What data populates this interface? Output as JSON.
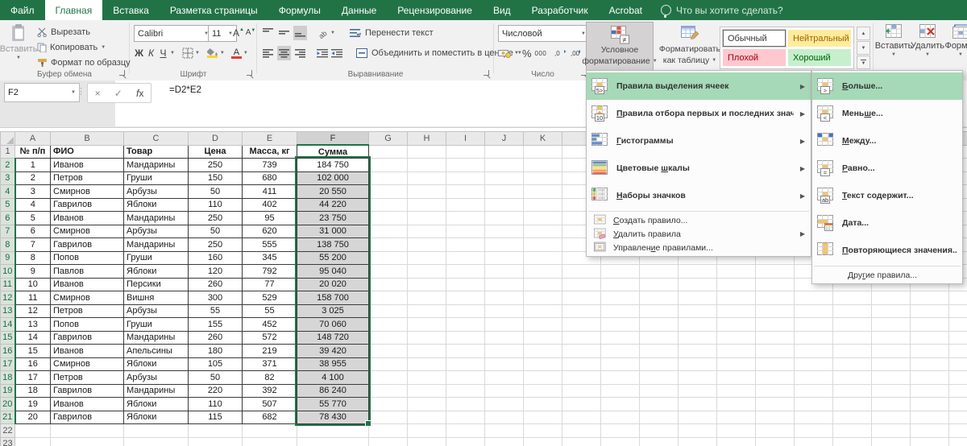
{
  "colors": {
    "excel_green": "#217346",
    "menu_highlight": "#A6D9B7",
    "selection_fill": "#D6D6D6",
    "selection_border": "#1F7245",
    "style_neutral_bg": "#FFEB9C",
    "style_neutral_fg": "#9C6500",
    "style_bad_bg": "#FFC7CE",
    "style_bad_fg": "#9C0006",
    "style_good_bg": "#C6EFCE",
    "style_good_fg": "#006100"
  },
  "tabs": {
    "items": [
      {
        "label": "Файл",
        "active": false
      },
      {
        "label": "Главная",
        "active": true
      },
      {
        "label": "Вставка",
        "active": false
      },
      {
        "label": "Разметка страницы",
        "active": false
      },
      {
        "label": "Формулы",
        "active": false
      },
      {
        "label": "Данные",
        "active": false
      },
      {
        "label": "Рецензирование",
        "active": false
      },
      {
        "label": "Вид",
        "active": false
      },
      {
        "label": "Разработчик",
        "active": false
      },
      {
        "label": "Acrobat",
        "active": false
      }
    ],
    "tell_me": "Что вы хотите сделать?"
  },
  "ribbon": {
    "clipboard": {
      "paste": "Вставить",
      "cut": "Вырезать",
      "copy": "Копировать",
      "format_painter": "Формат по образцу",
      "group": "Буфер обмена"
    },
    "font": {
      "name": "Calibri",
      "size": "11",
      "grow": "А",
      "shrink": "А",
      "bold": "Ж",
      "italic": "К",
      "underline": "Ч",
      "group": "Шрифт"
    },
    "alignment": {
      "wrap": "Перенести текст",
      "merge": "Объединить и поместить в центре",
      "group": "Выравнивание"
    },
    "number": {
      "format": "Числовой",
      "percent": "%",
      "zeros": "000",
      "group": "Число"
    },
    "styles": {
      "cond_line1": "Условное",
      "cond_line2": "форматирование",
      "table_line1": "Форматировать",
      "table_line2": "как таблицу",
      "chips": [
        {
          "label": "Обычный",
          "bg": "#FFFFFF",
          "fg": "#333333",
          "selected": true
        },
        {
          "label": "Нейтральный",
          "bg": "#FFEB9C",
          "fg": "#9C6500",
          "selected": false
        },
        {
          "label": "Плохой",
          "bg": "#FFC7CE",
          "fg": "#9C0006",
          "selected": false
        },
        {
          "label": "Хороший",
          "bg": "#C6EFCE",
          "fg": "#006100",
          "selected": false
        }
      ]
    },
    "cells": {
      "insert": "Вставить",
      "delete": "Удалить",
      "format": "Формат"
    }
  },
  "formula_bar": {
    "name_box": "F2",
    "formula": "=D2*E2"
  },
  "cf_menu": {
    "items": [
      {
        "label": "Правила выделения ячеек",
        "accel": -1,
        "icon": "highlight-cells-rules-icon",
        "sub": true,
        "hl": true
      },
      {
        "label": "Правила отбора первых и последних значений",
        "accel": 0,
        "icon": "top-bottom-rules-icon",
        "sub": true
      },
      {
        "label": "Гистограммы",
        "accel": 0,
        "icon": "data-bars-icon",
        "sub": true
      },
      {
        "label": "Цветовые шкалы",
        "accel": 9,
        "icon": "color-scales-icon",
        "sub": true
      },
      {
        "label": "Наборы значков",
        "accel": 0,
        "icon": "icon-sets-icon",
        "sub": true
      },
      {
        "sep": true
      },
      {
        "label": "Создать правило...",
        "accel": 0,
        "icon": "new-rule-icon",
        "small": true
      },
      {
        "label": "Удалить правила",
        "accel": 0,
        "icon": "clear-rules-icon",
        "small": true,
        "sub": true
      },
      {
        "label": "Управление правилами...",
        "accel": 8,
        "icon": "manage-rules-icon",
        "small": true
      }
    ]
  },
  "cf_submenu": {
    "items": [
      {
        "label": "Больше...",
        "accel": 0,
        "icon": "greater-than-icon",
        "hl": true
      },
      {
        "label": "Меньше...",
        "accel": 4,
        "icon": "less-than-icon"
      },
      {
        "label": "Между...",
        "accel": 0,
        "icon": "between-icon"
      },
      {
        "label": "Равно...",
        "accel": 0,
        "icon": "equal-to-icon"
      },
      {
        "label": "Текст содержит...",
        "accel": 0,
        "icon": "text-contains-icon"
      },
      {
        "label": "Дата...",
        "accel": 0,
        "icon": "date-icon"
      },
      {
        "label": "Повторяющиеся значения...",
        "accel": 0,
        "icon": "duplicate-values-icon"
      },
      {
        "sep": true
      },
      {
        "label": "Другие правила...",
        "accel": 3,
        "small": true,
        "noicon": true
      }
    ]
  },
  "sheet": {
    "col_headers": [
      "A",
      "B",
      "C",
      "D",
      "E",
      "F",
      "G",
      "H",
      "I",
      "J",
      "K"
    ],
    "selected_column": "F",
    "selected_rows": "2-21",
    "rows": [
      [
        "№ п/п",
        "ФИО",
        "Товар",
        "Цена",
        "Масса, кг",
        "Сумма"
      ],
      [
        "1",
        "Иванов",
        "Мандарины",
        "250",
        "739",
        "184 750"
      ],
      [
        "2",
        "Петров",
        "Груши",
        "150",
        "680",
        "102 000"
      ],
      [
        "3",
        "Смирнов",
        "Арбузы",
        "50",
        "411",
        "20 550"
      ],
      [
        "4",
        "Гаврилов",
        "Яблоки",
        "110",
        "402",
        "44 220"
      ],
      [
        "5",
        "Иванов",
        "Мандарины",
        "250",
        "95",
        "23 750"
      ],
      [
        "6",
        "Смирнов",
        "Арбузы",
        "50",
        "620",
        "31 000"
      ],
      [
        "7",
        "Гаврилов",
        "Мандарины",
        "250",
        "555",
        "138 750"
      ],
      [
        "8",
        "Попов",
        "Груши",
        "160",
        "345",
        "55 200"
      ],
      [
        "9",
        "Павлов",
        "Яблоки",
        "120",
        "792",
        "95 040"
      ],
      [
        "10",
        "Иванов",
        "Персики",
        "260",
        "77",
        "20 020"
      ],
      [
        "11",
        "Смирнов",
        "Вишня",
        "300",
        "529",
        "158 700"
      ],
      [
        "12",
        "Петров",
        "Арбузы",
        "55",
        "55",
        "3 025"
      ],
      [
        "13",
        "Попов",
        "Груши",
        "155",
        "452",
        "70 060"
      ],
      [
        "14",
        "Гаврилов",
        "Мандарины",
        "260",
        "572",
        "148 720"
      ],
      [
        "15",
        "Иванов",
        "Апельсины",
        "180",
        "219",
        "39 420"
      ],
      [
        "16",
        "Смирнов",
        "Яблоки",
        "105",
        "371",
        "38 955"
      ],
      [
        "17",
        "Петров",
        "Арбузы",
        "50",
        "82",
        "4 100"
      ],
      [
        "18",
        "Гаврилов",
        "Мандарины",
        "220",
        "392",
        "86 240"
      ],
      [
        "19",
        "Иванов",
        "Яблоки",
        "110",
        "507",
        "55 770"
      ],
      [
        "20",
        "Гаврилов",
        "Яблоки",
        "115",
        "682",
        "78 430"
      ]
    ]
  }
}
